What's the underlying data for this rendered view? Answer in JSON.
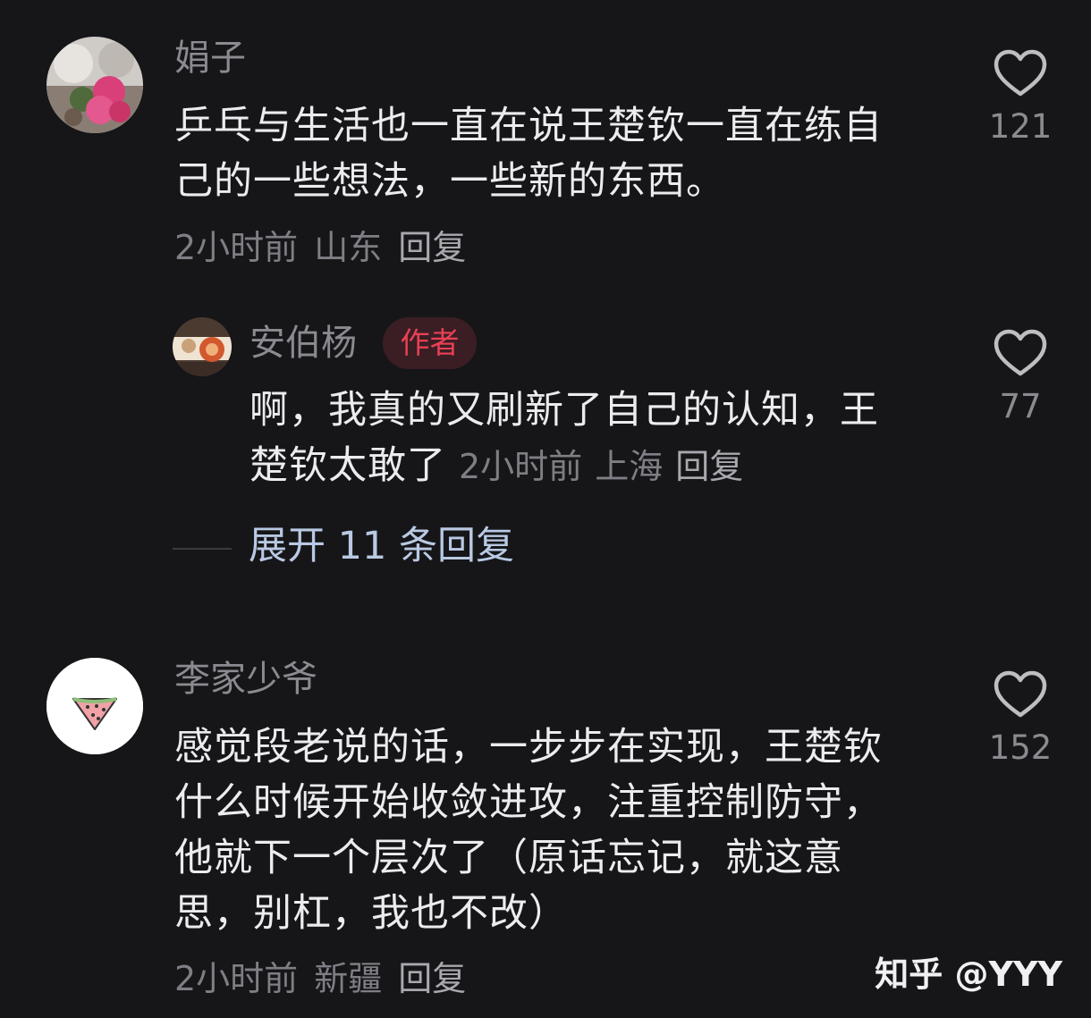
{
  "comments": [
    {
      "username": "娟子",
      "text_lines": [
        "乒乓与生活也一直在说王楚钦一直在练自",
        "己的一些想法，一些新的东西。"
      ],
      "time": "2小时前",
      "location": "山东",
      "reply_label": "回复",
      "likes": "121",
      "avatar_icon": "flower-bouquet-avatar-icon"
    },
    {
      "username": "李家少爷",
      "text_lines": [
        "感觉段老说的话，一步步在实现，王楚钦",
        "什么时候开始收敛进攻，注重控制防守，",
        "他就下一个层次了（原话忘记，就这意",
        "思，别杠，我也不改）"
      ],
      "time": "2小时前",
      "location": "新疆",
      "reply_label": "回复",
      "likes": "152",
      "avatar_icon": "watermelon-avatar-icon"
    }
  ],
  "reply": {
    "username": "安伯杨",
    "badge": "作者",
    "text_line1": "啊，我真的又刷新了自己的认知，王",
    "text_line2": "楚钦太敢了",
    "time": "2小时前",
    "location": "上海",
    "reply_label": "回复",
    "likes": "77",
    "avatar_icon": "decorative-avatar-icon"
  },
  "expand_replies": "展开 11 条回复",
  "watermark": "知乎 @YYY",
  "colors": {
    "background": "#161619",
    "badge_text": "#ea4055",
    "expand_link": "#b9c9e3"
  }
}
